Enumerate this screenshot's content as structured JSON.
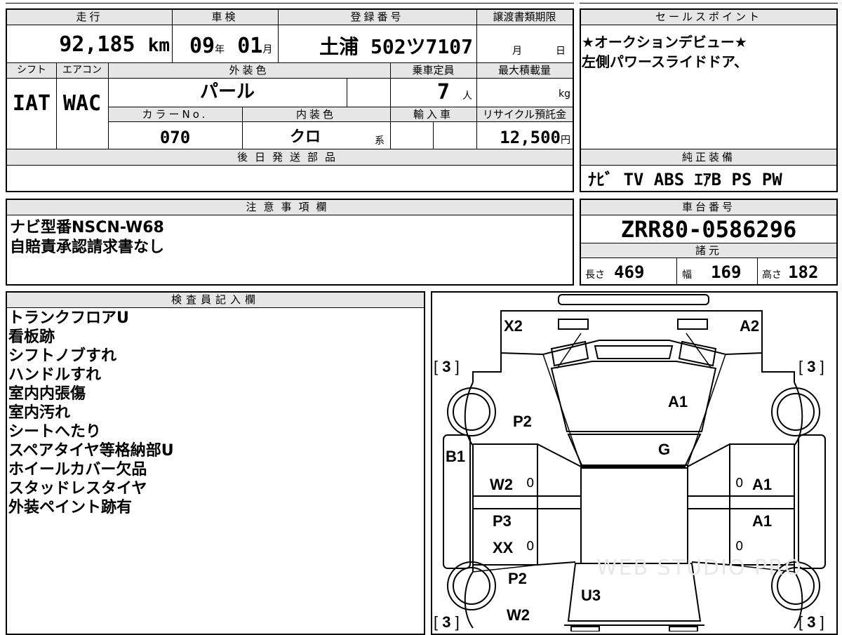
{
  "header": {
    "mileage_label": "走行",
    "mileage": "92,185",
    "mileage_unit": "km",
    "inspection_label": "車検",
    "inspection_year": "09",
    "year_unit": "年",
    "inspection_month": "01",
    "month_unit": "月",
    "registration_label": "登録番号",
    "registration": "土浦 502ツ7107",
    "transfer_label": "譲渡書類期限",
    "transfer_month_unit": "月",
    "transfer_day_unit": "日",
    "shift_label": "シフト",
    "shift": "IAT",
    "ac_label": "エアコン",
    "ac": "WAC",
    "exterior_color_label": "外装色",
    "exterior_color": "パール",
    "capacity_label": "乗車定員",
    "capacity": "7",
    "capacity_unit": "人",
    "max_load_label": "最大積載量",
    "max_load_unit": "kg",
    "color_no_label": "カラーNo.",
    "color_no": "070",
    "interior_color_label": "内装色",
    "interior_color": "クロ",
    "interior_color_unit": "系",
    "import_label": "輸入車",
    "recycle_label": "リサイクル預託金",
    "recycle_fee": "12,500",
    "recycle_unit": "円",
    "later_parts_label": "後日発送部品"
  },
  "sales_points": {
    "label": "セールスポイント",
    "lines": [
      "★オークションデビュー★",
      "左側パワースライドドア、"
    ]
  },
  "genuine_equipment": {
    "label": "純正装備",
    "value": "ﾅﾋﾞ TV ABS ｴｱB PS PW"
  },
  "notes": {
    "label": "注意事項欄",
    "lines": [
      "ナビ型番NSCN-W68",
      "自賠責承認請求書なし"
    ]
  },
  "chassis": {
    "label": "車台番号",
    "value": "ZRR80-0586296"
  },
  "specs": {
    "label": "諸元",
    "length_label": "長さ",
    "length": "469",
    "width_label": "幅",
    "width": "169",
    "height_label": "高さ",
    "height": "182"
  },
  "inspector": {
    "label": "検査員記入欄",
    "lines": [
      "トランクフロアU",
      "看板跡",
      "シフトノブすれ",
      "ハンドルすれ",
      "室内内張傷",
      "室内汚れ",
      "シートへたり",
      "スペアタイヤ等格納部U",
      "ホイールカバー欠品",
      "スタッドレスタイヤ",
      "外装ペイント跡有"
    ]
  },
  "diagram": {
    "marks": {
      "x2": "X2",
      "a2": "A2",
      "a1_hood": "A1",
      "p2_front": "P2",
      "g": "G",
      "b1": "B1",
      "w2_left": "W2",
      "a1_right_front": "A1",
      "a1_right_rear": "A1",
      "p3": "P3",
      "xx": "XX",
      "p2_rear": "P2",
      "u3": "U3",
      "w2_rear": "W2"
    },
    "tire": [
      "3",
      "3",
      "3",
      "3"
    ],
    "zeros": [
      "0",
      "0",
      "0",
      "0"
    ],
    "watermark": "WEB STUDIO PRO"
  }
}
